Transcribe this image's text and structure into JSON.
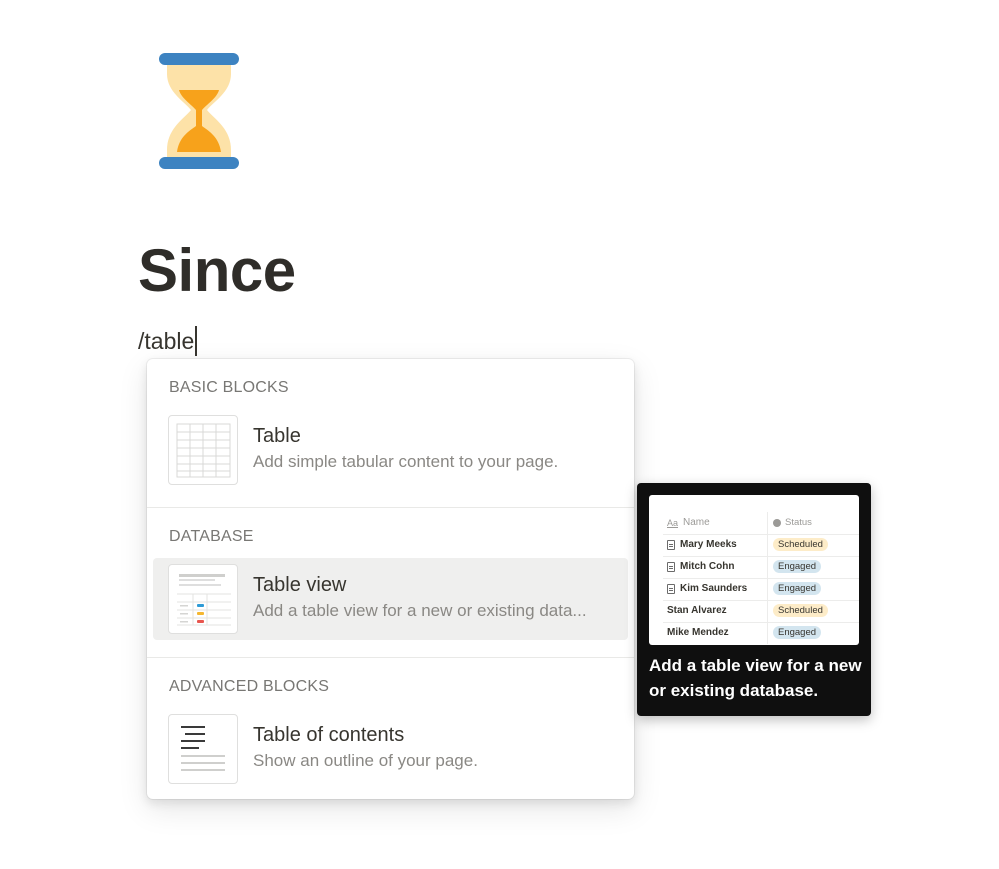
{
  "page": {
    "icon": "hourglass-icon",
    "title": "Since",
    "editor_text": "/table"
  },
  "menu": {
    "sections": [
      {
        "title": "BASIC BLOCKS",
        "items": [
          {
            "icon": "simple-table-thumbnail",
            "title": "Table",
            "description": "Add simple tabular content to your page."
          }
        ]
      },
      {
        "title": "DATABASE",
        "items": [
          {
            "icon": "table-view-thumbnail",
            "title": "Table view",
            "description": "Add a table view for a new or existing data..."
          }
        ]
      },
      {
        "title": "ADVANCED BLOCKS",
        "items": [
          {
            "icon": "table-of-contents-thumbnail",
            "title": "Table of contents",
            "description": "Show an outline of your page."
          }
        ]
      }
    ]
  },
  "tooltip": {
    "text": "Add a table view for a new or existing database.",
    "preview": {
      "columns": [
        "Name",
        "Status"
      ],
      "rows": [
        {
          "name": "Mary Meeks",
          "status": "Scheduled"
        },
        {
          "name": "Mitch Cohn",
          "status": "Engaged"
        },
        {
          "name": "Kim Saunders",
          "status": "Engaged"
        },
        {
          "name": "Stan Alvarez",
          "status": "Scheduled"
        },
        {
          "name": "Mike Mendez",
          "status": "Engaged"
        }
      ]
    }
  },
  "colors": {
    "hourglass_frame": "#3d83c1",
    "hourglass_glass": "#fde2a8",
    "hourglass_sand": "#f7a21b",
    "selected_row": "#efefee",
    "tooltip_bg": "#0f0f0f",
    "status_scheduled": "#fdecc8",
    "status_engaged": "#d3e5ef"
  }
}
